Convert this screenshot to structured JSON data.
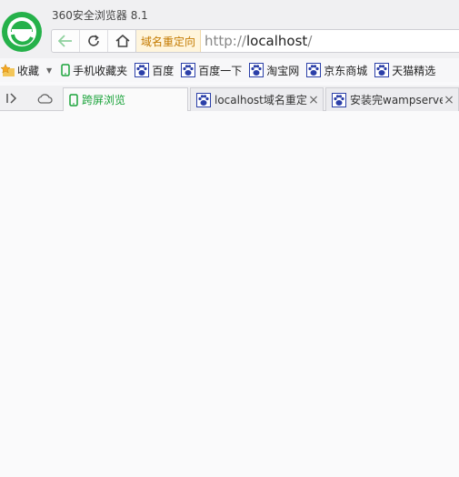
{
  "app": {
    "title": "360安全浏览器 8.1"
  },
  "nav": {
    "back_icon": "back-arrow-icon",
    "refresh_icon": "refresh-icon",
    "home_icon": "home-icon"
  },
  "addressbar": {
    "redirect_badge": "域名重定向",
    "url_scheme": "http://",
    "url_host": "localhost",
    "url_path": "/"
  },
  "bookmarks": {
    "favorites_label": "收藏",
    "items": [
      {
        "label": "手机收藏夹",
        "icon": "phone-icon"
      },
      {
        "label": "百度",
        "icon": "baidu-paw-icon"
      },
      {
        "label": "百度一下",
        "icon": "baidu-paw-icon"
      },
      {
        "label": "淘宝网",
        "icon": "baidu-paw-icon"
      },
      {
        "label": "京东商城",
        "icon": "baidu-paw-icon"
      },
      {
        "label": "天猫精选",
        "icon": "baidu-paw-icon"
      }
    ]
  },
  "tabs": [
    {
      "label": "跨屏浏览",
      "icon": "phone-icon"
    },
    {
      "label": "localhost域名重定向",
      "icon": "baidu-paw-icon"
    },
    {
      "label": "安装完wampserver",
      "icon": "baidu-paw-icon"
    }
  ],
  "colors": {
    "accent_green": "#1aa33a",
    "paw_blue": "#2b3fa8",
    "redirect_orange": "#c47a00"
  }
}
